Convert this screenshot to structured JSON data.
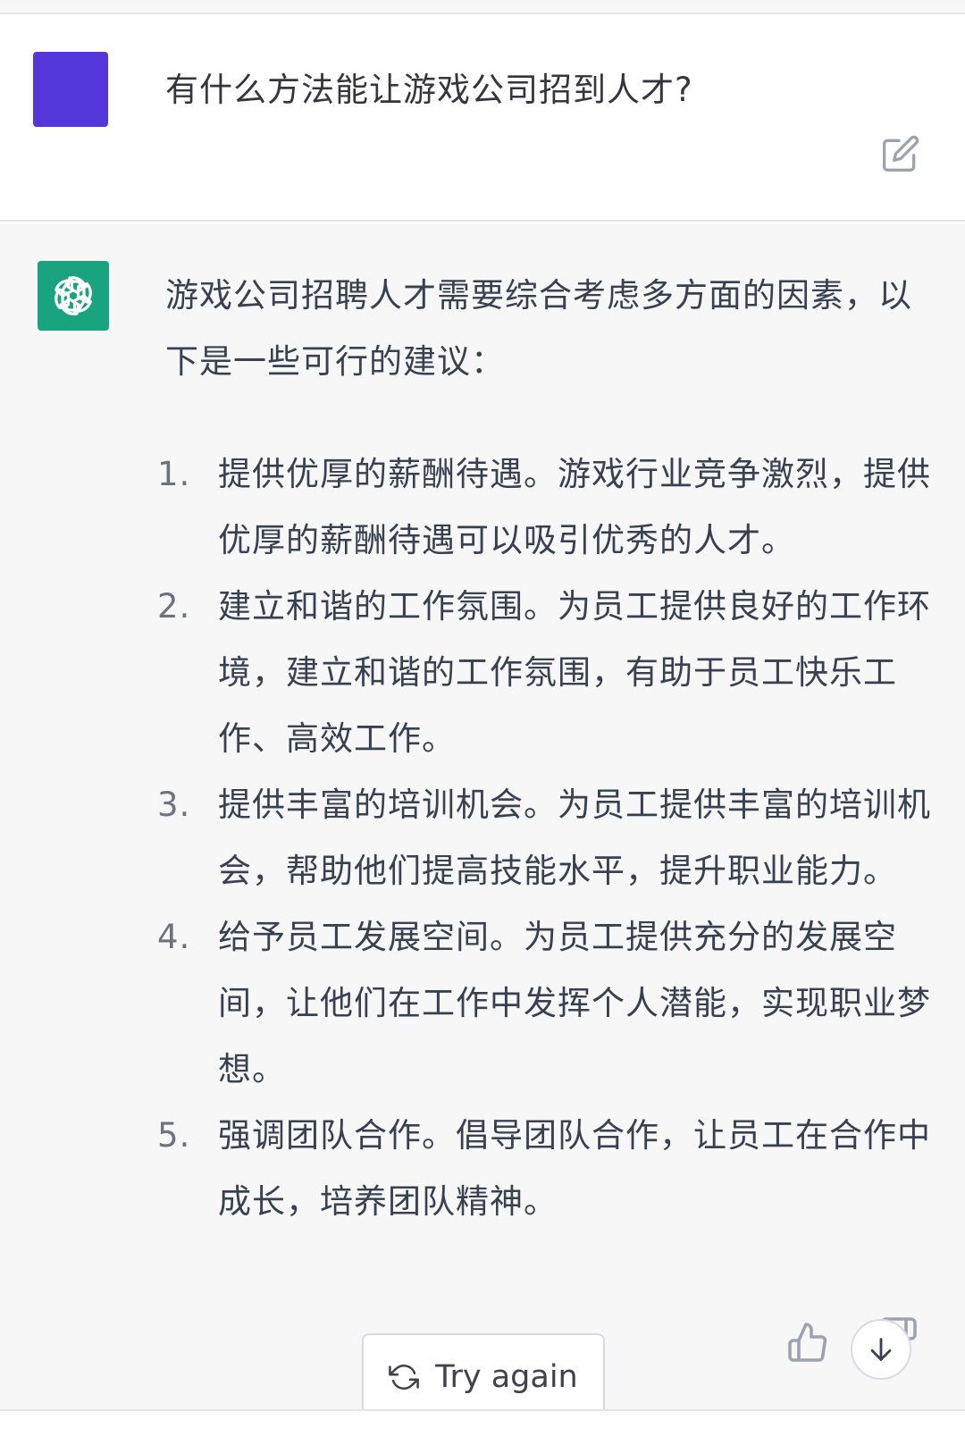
{
  "colors": {
    "user_avatar": "#5436da",
    "assistant_avatar": "#19a37e",
    "assistant_background": "#f7f7f8"
  },
  "user_message": {
    "text": "有什么方法能让游戏公司招到人才?",
    "edit_icon": "edit-icon"
  },
  "assistant_message": {
    "avatar_icon": "openai-logo-icon",
    "intro": "游戏公司招聘人才需要综合考虑多方面的因素，以下是一些可行的建议：",
    "items": [
      {
        "num": "1.",
        "text": "提供优厚的薪酬待遇。游戏行业竞争激烈，提供优厚的薪酬待遇可以吸引优秀的人才。"
      },
      {
        "num": "2.",
        "text": "建立和谐的工作氛围。为员工提供良好的工作环境，建立和谐的工作氛围，有助于员工快乐工作、高效工作。"
      },
      {
        "num": "3.",
        "text": "提供丰富的培训机会。为员工提供丰富的培训机会，帮助他们提高技能水平，提升职业能力。"
      },
      {
        "num": "4.",
        "text": "给予员工发展空间。为员工提供充分的发展空间，让他们在工作中发挥个人潜能，实现职业梦想。"
      },
      {
        "num": "5.",
        "text": "强调团队合作。倡导团队合作，让员工在合作中成长，培养团队精神。"
      }
    ]
  },
  "actions": {
    "try_again_label": "Try again",
    "try_again_icon": "refresh-icon",
    "thumbs_up_icon": "thumbs-up-icon",
    "thumbs_down_icon": "thumbs-down-icon",
    "scroll_down_icon": "arrow-down-icon"
  }
}
